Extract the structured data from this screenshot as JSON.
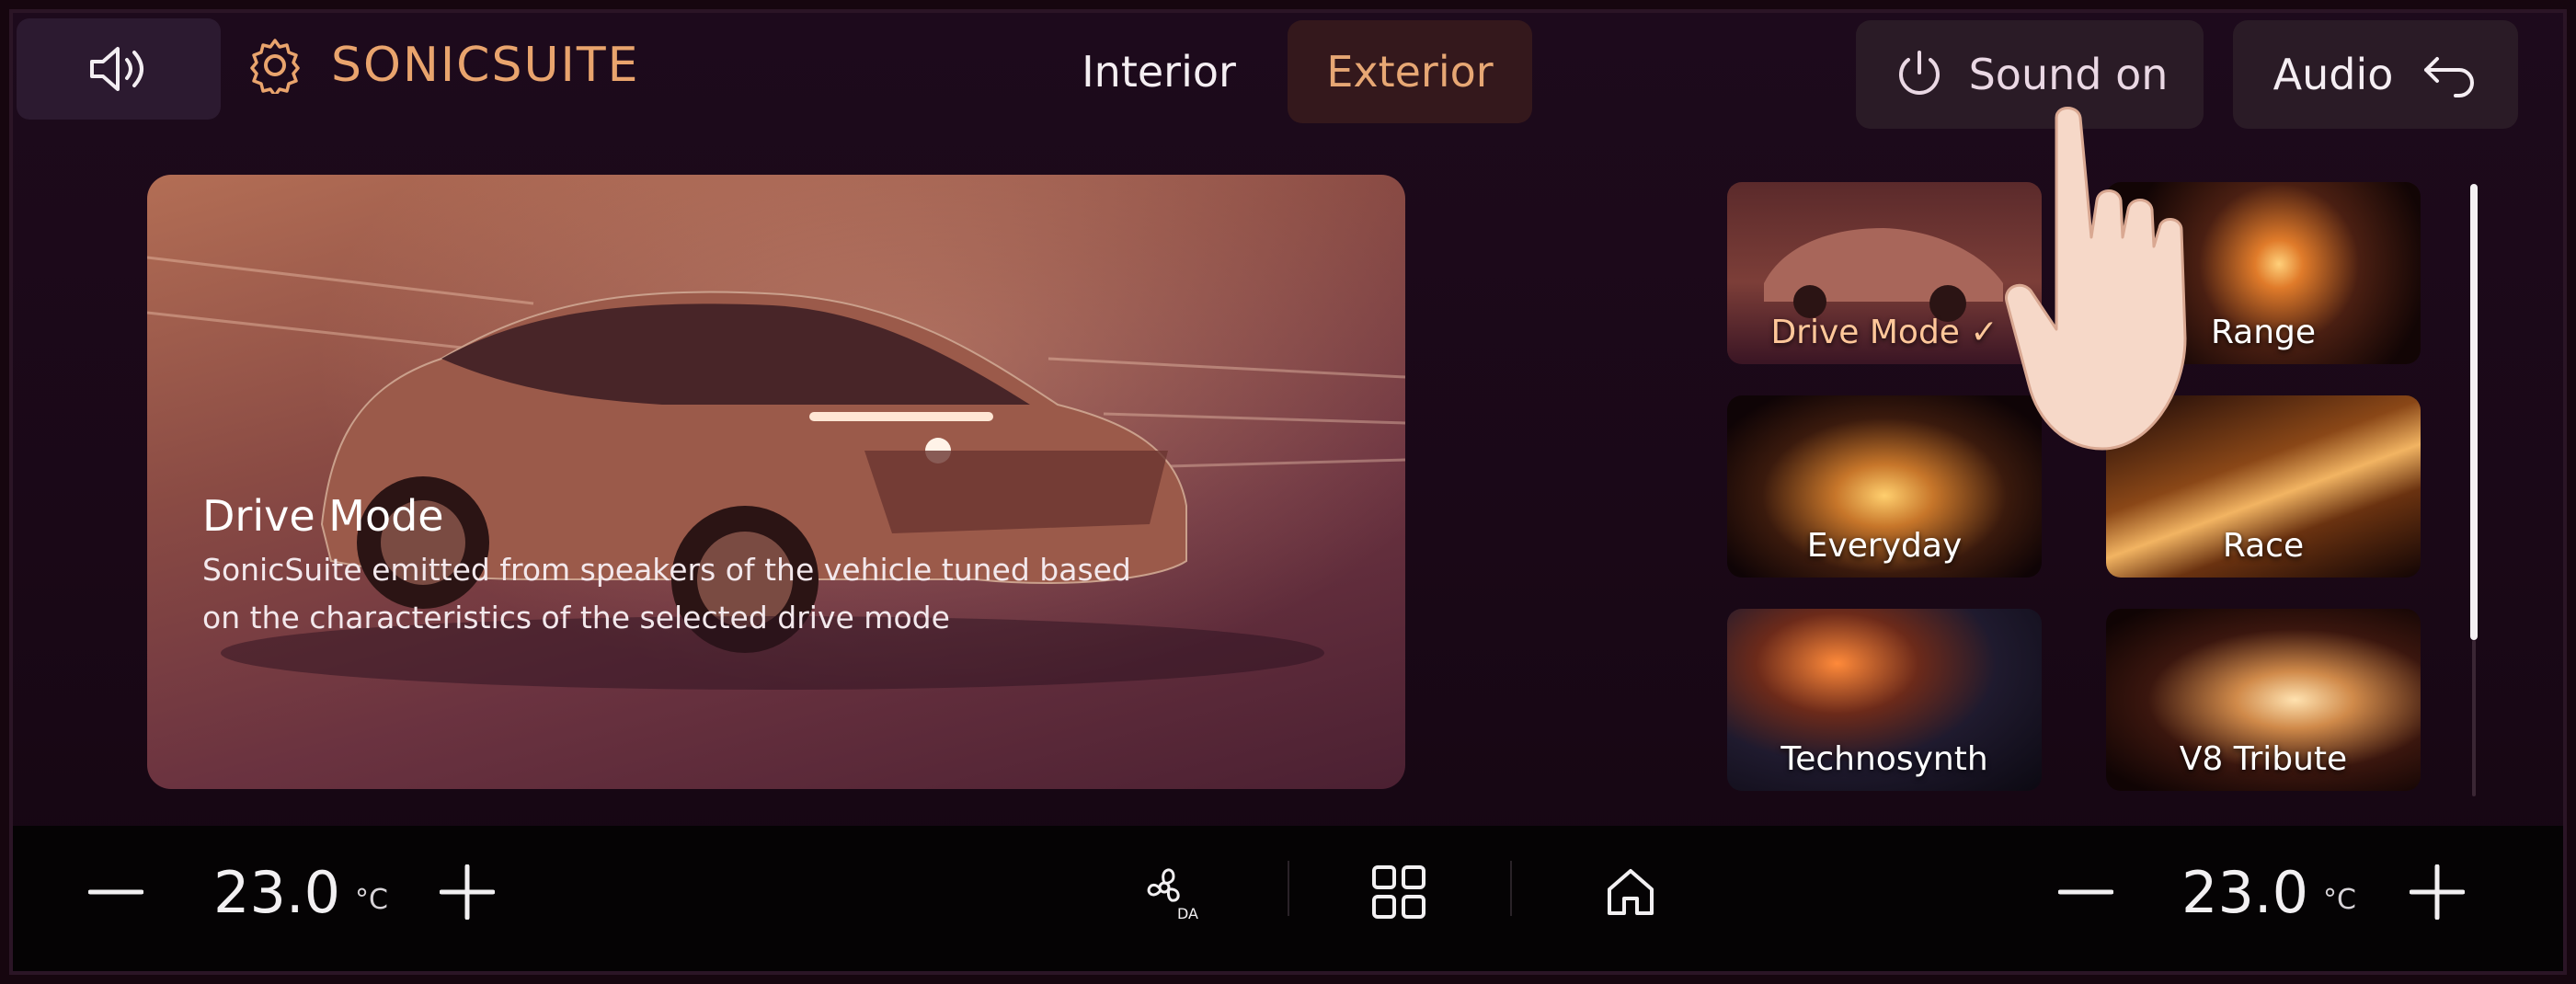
{
  "header": {
    "brand_title": "SONICSUITE",
    "tabs": [
      {
        "label": "Interior",
        "active": false
      },
      {
        "label": "Exterior",
        "active": true
      }
    ],
    "sound_button_label": "Sound on",
    "audio_button_label": "Audio"
  },
  "hero": {
    "title": "Drive Mode",
    "description": "SonicSuite emitted from speakers of the vehicle tuned based on the characteristics of the selected drive mode"
  },
  "modes": [
    {
      "label": "Drive Mode ✓",
      "selected": true
    },
    {
      "label": "Range",
      "selected": false
    },
    {
      "label": "Everyday",
      "selected": false
    },
    {
      "label": "Race",
      "selected": false
    },
    {
      "label": "Technosynth",
      "selected": false
    },
    {
      "label": "V8 Tribute",
      "selected": false
    }
  ],
  "climate": {
    "left": {
      "temperature": "23.0",
      "unit": "°C"
    },
    "right": {
      "temperature": "23.0",
      "unit": "°C"
    }
  },
  "colors": {
    "accent": "#e9a46d",
    "background": "#1a0817",
    "button_bg": "#2a1b26"
  },
  "icons": {
    "speaker": "speaker-icon",
    "settings": "gear-icon",
    "power": "power-icon",
    "back": "back-arrow-icon",
    "fan": "fan-auto-icon",
    "apps": "grid-icon",
    "home": "home-icon"
  }
}
